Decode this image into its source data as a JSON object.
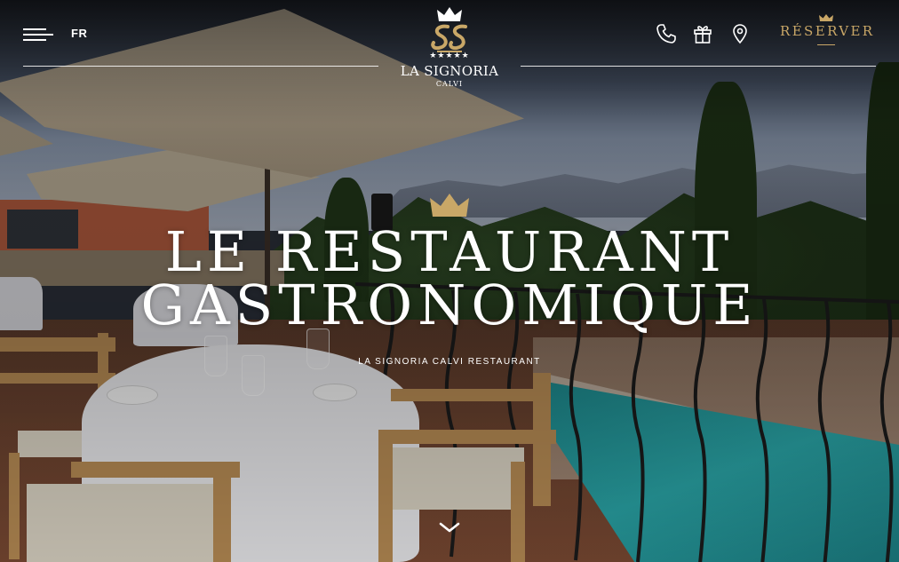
{
  "header": {
    "language": "FR",
    "logo": {
      "stars": "★★★★★",
      "name": "LA SIGNORIA",
      "city": "CALVI"
    },
    "icons": [
      "phone-icon",
      "gift-icon",
      "map-pin-icon"
    ],
    "reserve_label": "RÉSERVER"
  },
  "hero": {
    "title_line1": "LE RESTAURANT",
    "title_line2": "GASTRONOMIQUE",
    "subtitle": "LA SIGNORIA CALVI RESTAURANT"
  },
  "colors": {
    "gold": "#c9a767",
    "text": "#ffffff"
  }
}
